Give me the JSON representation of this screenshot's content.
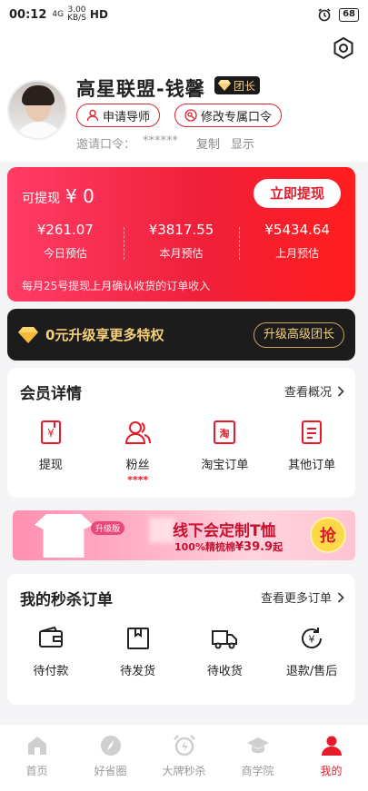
{
  "status_bar": {
    "time": "00:12",
    "net_type": "4G",
    "net_speed": "3.00",
    "net_unit": "KB/S",
    "hd": "HD",
    "battery": "68"
  },
  "profile": {
    "name": "高星联盟-钱馨",
    "badge": "团长",
    "apply_mentor": "申请导师",
    "modify_code": "修改专属口令",
    "invite_label": "邀请口令：",
    "invite_code": "******",
    "copy": "复制",
    "show": "显示"
  },
  "earnings": {
    "withdrawable_label": "可提现",
    "withdrawable_value": "¥ 0",
    "withdraw_button": "立即提现",
    "stats": [
      {
        "value": "¥261.07",
        "label": "今日预估"
      },
      {
        "value": "¥3817.55",
        "label": "本月预估"
      },
      {
        "value": "¥5434.64",
        "label": "上月预估"
      }
    ],
    "note": "每月25号提现上月确认收货的订单收入"
  },
  "upgrade": {
    "text": "0元升级享更多特权",
    "button": "升级高级团长"
  },
  "member": {
    "title": "会员详情",
    "more": "查看概况",
    "items": [
      {
        "label": "提现",
        "icon": "withdraw-icon"
      },
      {
        "label": "粉丝",
        "icon": "fans-icon",
        "sub": "****"
      },
      {
        "label": "淘宝订单",
        "icon": "taobao-icon"
      },
      {
        "label": "其他订单",
        "icon": "other-orders-icon"
      }
    ]
  },
  "banner": {
    "tag": "升级版",
    "headline": "线下会定制T恤",
    "sub_prefix": "100%精梳棉",
    "price": "¥39.9",
    "sub_suffix": "起",
    "grab": "抢"
  },
  "flash_orders": {
    "title": "我的秒杀订单",
    "more": "查看更多订单",
    "items": [
      {
        "label": "待付款",
        "icon": "wallet-icon"
      },
      {
        "label": "待发货",
        "icon": "package-icon"
      },
      {
        "label": "待收货",
        "icon": "truck-icon"
      },
      {
        "label": "退款/售后",
        "icon": "refund-icon"
      }
    ]
  },
  "tabs": [
    {
      "label": "首页",
      "icon": "home-icon",
      "active": false
    },
    {
      "label": "好省圈",
      "icon": "compass-icon",
      "active": false
    },
    {
      "label": "大牌秒杀",
      "icon": "alarm-clock-icon",
      "active": false
    },
    {
      "label": "商学院",
      "icon": "graduation-cap-icon",
      "active": false
    },
    {
      "label": "我的",
      "icon": "person-icon",
      "active": true
    }
  ],
  "colors": {
    "brand_red": "#e51a2b",
    "gold": "#f6d07a",
    "dark": "#1c1c1c"
  }
}
